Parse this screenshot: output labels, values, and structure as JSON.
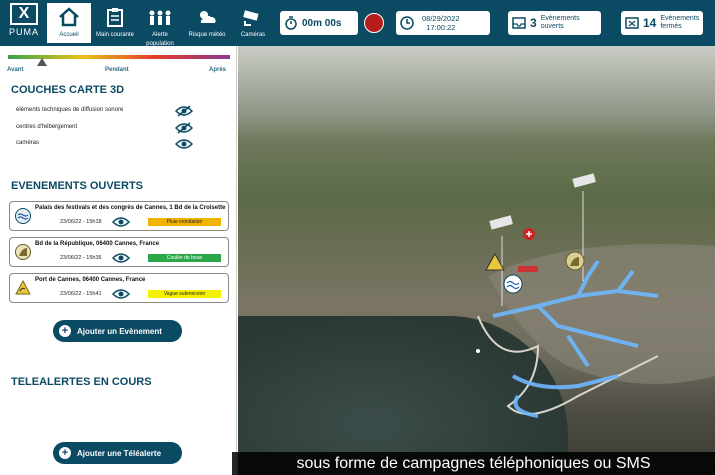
{
  "logo": {
    "name": "PUMA",
    "mark": "X"
  },
  "nav": [
    {
      "label": "Accueil",
      "icon": "home-icon"
    },
    {
      "label": "Main courante",
      "icon": "clipboard-icon"
    },
    {
      "label": "Alerte population",
      "icon": "people-icon"
    },
    {
      "label": "Risque météo",
      "icon": "weather-icon"
    },
    {
      "label": "Caméras",
      "icon": "camera-icon"
    }
  ],
  "timer": {
    "value": "00m 00s"
  },
  "datetime": {
    "date": "08/29/2022",
    "time": "17:00:22"
  },
  "open_events": {
    "count": "3",
    "label": "Evènements ouverts"
  },
  "closed_events": {
    "count": "14",
    "label": "Evènements fermés"
  },
  "scale": {
    "before": "Avant",
    "during": "Pendant",
    "after": "Après"
  },
  "layers": {
    "title": "COUCHES CARTE 3D",
    "items": [
      {
        "label": "éléments techniques de diffusion sonore",
        "visible": false
      },
      {
        "label": "centres d'hébergement",
        "visible": false
      },
      {
        "label": "caméras",
        "visible": true
      }
    ]
  },
  "events": {
    "title": "EVENEMENTS OUVERTS",
    "items": [
      {
        "address": "Palais des festivals et des congrès de Cannes, 1 Bd de la Croisette",
        "date": "23/06/22 - 15h18",
        "type": "Pluie inondation",
        "color": "#f0b400",
        "icon": "flood-icon"
      },
      {
        "address": "Bd de la République, 06400 Cannes, France",
        "date": "23/06/22 - 15h36",
        "type": "Coulée de boue",
        "color": "#2aa84a",
        "icon": "mudslide-icon"
      },
      {
        "address": "Port de Cannes, 06400 Cannes, France",
        "date": "23/06/22 - 15h41",
        "type": "Vague submersion",
        "color": "#f4f000",
        "icon": "wave-icon"
      }
    ],
    "add_label": "Ajouter un Evènement"
  },
  "telealerts": {
    "title": "TELEALERTES EN COURS",
    "add_label": "Ajouter une Téléalerte"
  },
  "caption": "sous forme de campagnes téléphoniques ou SMS"
}
